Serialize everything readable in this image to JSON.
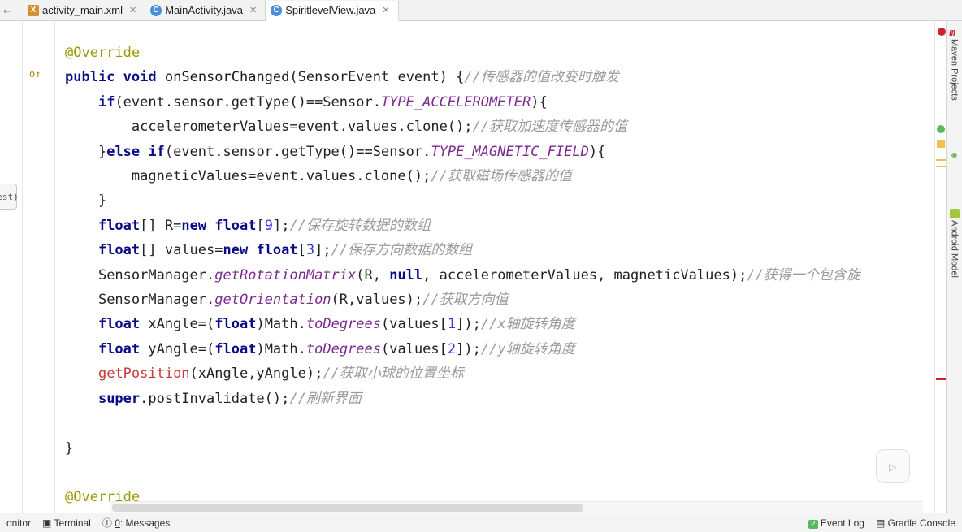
{
  "tabs": [
    {
      "name": "activity_main.xml",
      "icon": "X",
      "active": false
    },
    {
      "name": "MainActivity.java",
      "icon": "C",
      "active": false
    },
    {
      "name": "SpiritlevelView.java",
      "icon": "C",
      "active": true
    }
  ],
  "left_stub": "est)",
  "code": {
    "l1_ann": "@Override",
    "l2_kw1": "public",
    "l2_kw2": "void",
    "l2_m": "onSensorChanged",
    "l2_sig": "(SensorEvent event) {",
    "l2_cm": "//传感器的值改变时触发",
    "l3_kw": "if",
    "l3_a": "(event.sensor.getType()==Sensor.",
    "l3_sm": "TYPE_ACCELEROMETER",
    "l3_b": "){",
    "l4_a": "accelerometerValues=event.values.clone();",
    "l4_cm": "//获取加速度传感器的值",
    "l5_a": "}",
    "l5_kw": "else if",
    "l5_b": "(event.sensor.getType()==Sensor.",
    "l5_sm": "TYPE_MAGNETIC_FIELD",
    "l5_c": "){",
    "l6_a": "magneticValues=event.values.clone();",
    "l6_cm": "//获取磁场传感器的值",
    "l7": "}",
    "l8_kw": "float",
    "l8_a": "[] R=",
    "l8_kw2": "new float",
    "l8_b": "[",
    "l8_n": "9",
    "l8_c": "];",
    "l8_cm": "//保存旋转数据的数组",
    "l9_kw": "float",
    "l9_a": "[] values=",
    "l9_kw2": "new float",
    "l9_b": "[",
    "l9_n": "3",
    "l9_c": "];",
    "l9_cm": "//保存方向数据的数组",
    "l10_a": "SensorManager.",
    "l10_m": "getRotationMatrix",
    "l10_b": "(R, ",
    "l10_kw": "null",
    "l10_c": ", accelerometerValues, magneticValues);",
    "l10_cm": "//获得一个包含旋",
    "l11_a": "SensorManager.",
    "l11_m": "getOrientation",
    "l11_b": "(R,values);",
    "l11_cm": "//获取方向值",
    "l12_kw": "float",
    "l12_a": " xAngle=(",
    "l12_kw2": "float",
    "l12_b": ")Math.",
    "l12_m": "toDegrees",
    "l12_c": "(values[",
    "l12_n": "1",
    "l12_d": "]);",
    "l12_cm": "//x轴旋转角度",
    "l13_kw": "float",
    "l13_a": " yAngle=(",
    "l13_kw2": "float",
    "l13_b": ")Math.",
    "l13_m": "toDegrees",
    "l13_c": "(values[",
    "l13_n": "2",
    "l13_d": "]);",
    "l13_cm": "//y轴旋转角度",
    "l14_m": "getPosition",
    "l14_a": "(xAngle,yAngle);",
    "l14_cm": "//获取小球的位置坐标",
    "l15_kw": "super",
    "l15_a": ".postInvalidate();",
    "l15_cm": "//刷新界面",
    "l17": "}",
    "l19_ann": "@Override"
  },
  "rightbar": {
    "maven": "Maven Projects",
    "android": "Android Model"
  },
  "status": {
    "monitor": "onitor",
    "terminal": "Terminal",
    "msgnum": "0",
    "messages": ": Messages",
    "evnum": "2",
    "eventlog": "Event Log",
    "gradle": "Gradle Console"
  }
}
